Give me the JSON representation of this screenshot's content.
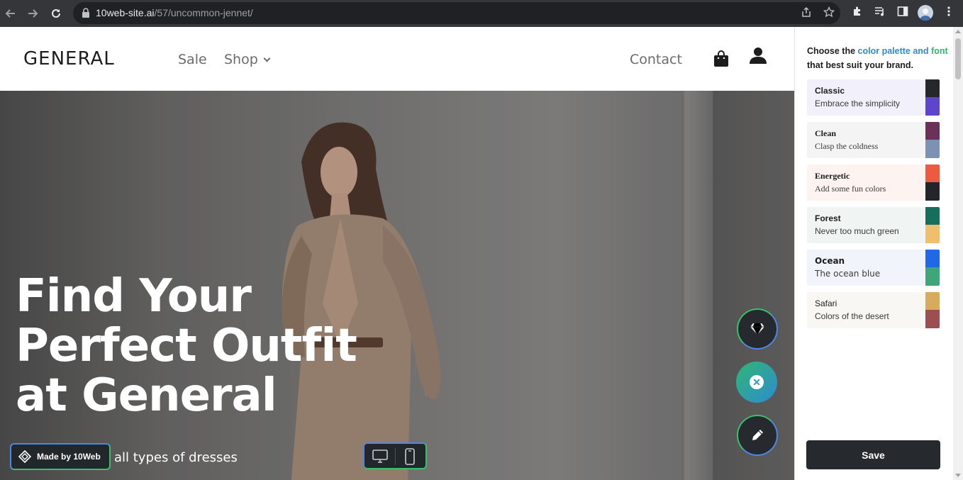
{
  "browser": {
    "url_host": "10web-site.ai",
    "url_path": "/57/uncommon-jennet/"
  },
  "site": {
    "logo": "GENERAL",
    "nav": {
      "sale": "Sale",
      "shop": "Shop",
      "contact": "Contact"
    },
    "hero": {
      "line1": "Find Your",
      "line2": "Perfect Outfit",
      "line3": "at General",
      "subtext": "all types of dresses"
    },
    "made_by": "Made by 10Web"
  },
  "panel": {
    "intro_prefix": "Choose the ",
    "intro_hl1": "color palette and",
    "intro_hl2": "font",
    "intro_suffix": " that best suit your brand.",
    "palettes": [
      {
        "name": "Classic",
        "desc": "Embrace the simplicity",
        "bg": "#f2f1fb",
        "c1": "#26272b",
        "c2": "#5f44cc"
      },
      {
        "name": "Clean",
        "desc": "Clasp the coldness",
        "bg": "#f4f4f5",
        "c1": "#6c3158",
        "c2": "#7c92b5"
      },
      {
        "name": "Energetic",
        "desc": "Add some fun colors",
        "bg": "#fdf3f1",
        "c1": "#ec5a3f",
        "c2": "#23252a"
      },
      {
        "name": "Forest",
        "desc": "Never too much green",
        "bg": "#f0f4f3",
        "c1": "#166e5d",
        "c2": "#f0bf6d"
      },
      {
        "name": "Ocean",
        "desc": "The ocean blue",
        "bg": "#f1f5fb",
        "c1": "#2168e6",
        "c2": "#3ea77a"
      },
      {
        "name": "Safari",
        "desc": "Colors of the desert",
        "bg": "#f8f7f3",
        "c1": "#d8aa5c",
        "c2": "#9b4f50"
      }
    ],
    "save_label": "Save"
  },
  "icons": {
    "back": "arrow-left-icon",
    "forward": "arrow-right-icon",
    "reload": "reload-icon",
    "share": "share-icon",
    "bookmark": "star-icon",
    "extensions": "puzzle-icon",
    "media": "media-icon",
    "sidepanel": "side-panel-icon",
    "menu": "more-icon"
  }
}
